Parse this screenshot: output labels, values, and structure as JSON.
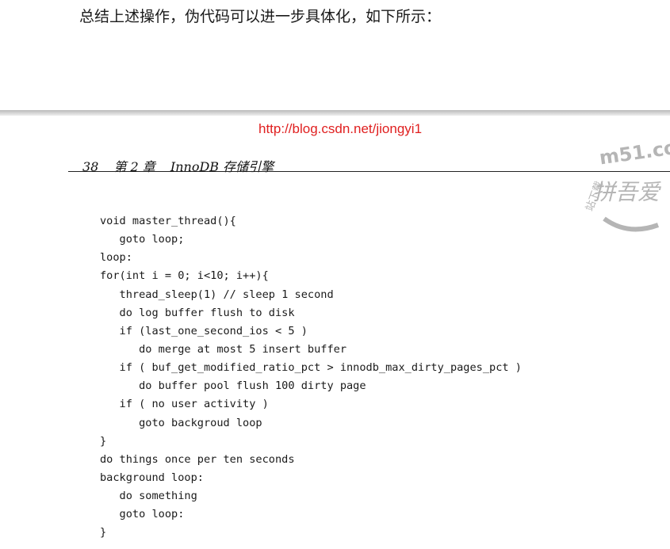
{
  "intro_text": "总结上述操作，伪代码可以进一步具体化，如下所示：",
  "watermark_url": "http://blog.csdn.net/jiongyi1",
  "running_head": {
    "page_number": "38",
    "chapter": "第 2 章",
    "title": "InnoDB 存储引擎"
  },
  "stamp": {
    "text_top": "m51.co",
    "text_center": "拼吾爱",
    "text_side": "站下载",
    "color": "#b5b5b5"
  },
  "code_lines": [
    "void master_thread(){",
    "   goto loop;",
    "loop:",
    "for(int i = 0; i<10; i++){",
    "   thread_sleep(1) // sleep 1 second",
    "   do log buffer flush to disk",
    "   if (last_one_second_ios < 5 )",
    "      do merge at most 5 insert buffer",
    "   if ( buf_get_modified_ratio_pct > innodb_max_dirty_pages_pct )",
    "      do buffer pool flush 100 dirty page",
    "   if ( no user activity )",
    "      goto backgroud loop",
    "}",
    "do things once per ten seconds",
    "background loop:",
    "   do something",
    "   goto loop:",
    "}"
  ],
  "colors": {
    "url": "#e02020",
    "text": "#1a1a1a"
  }
}
